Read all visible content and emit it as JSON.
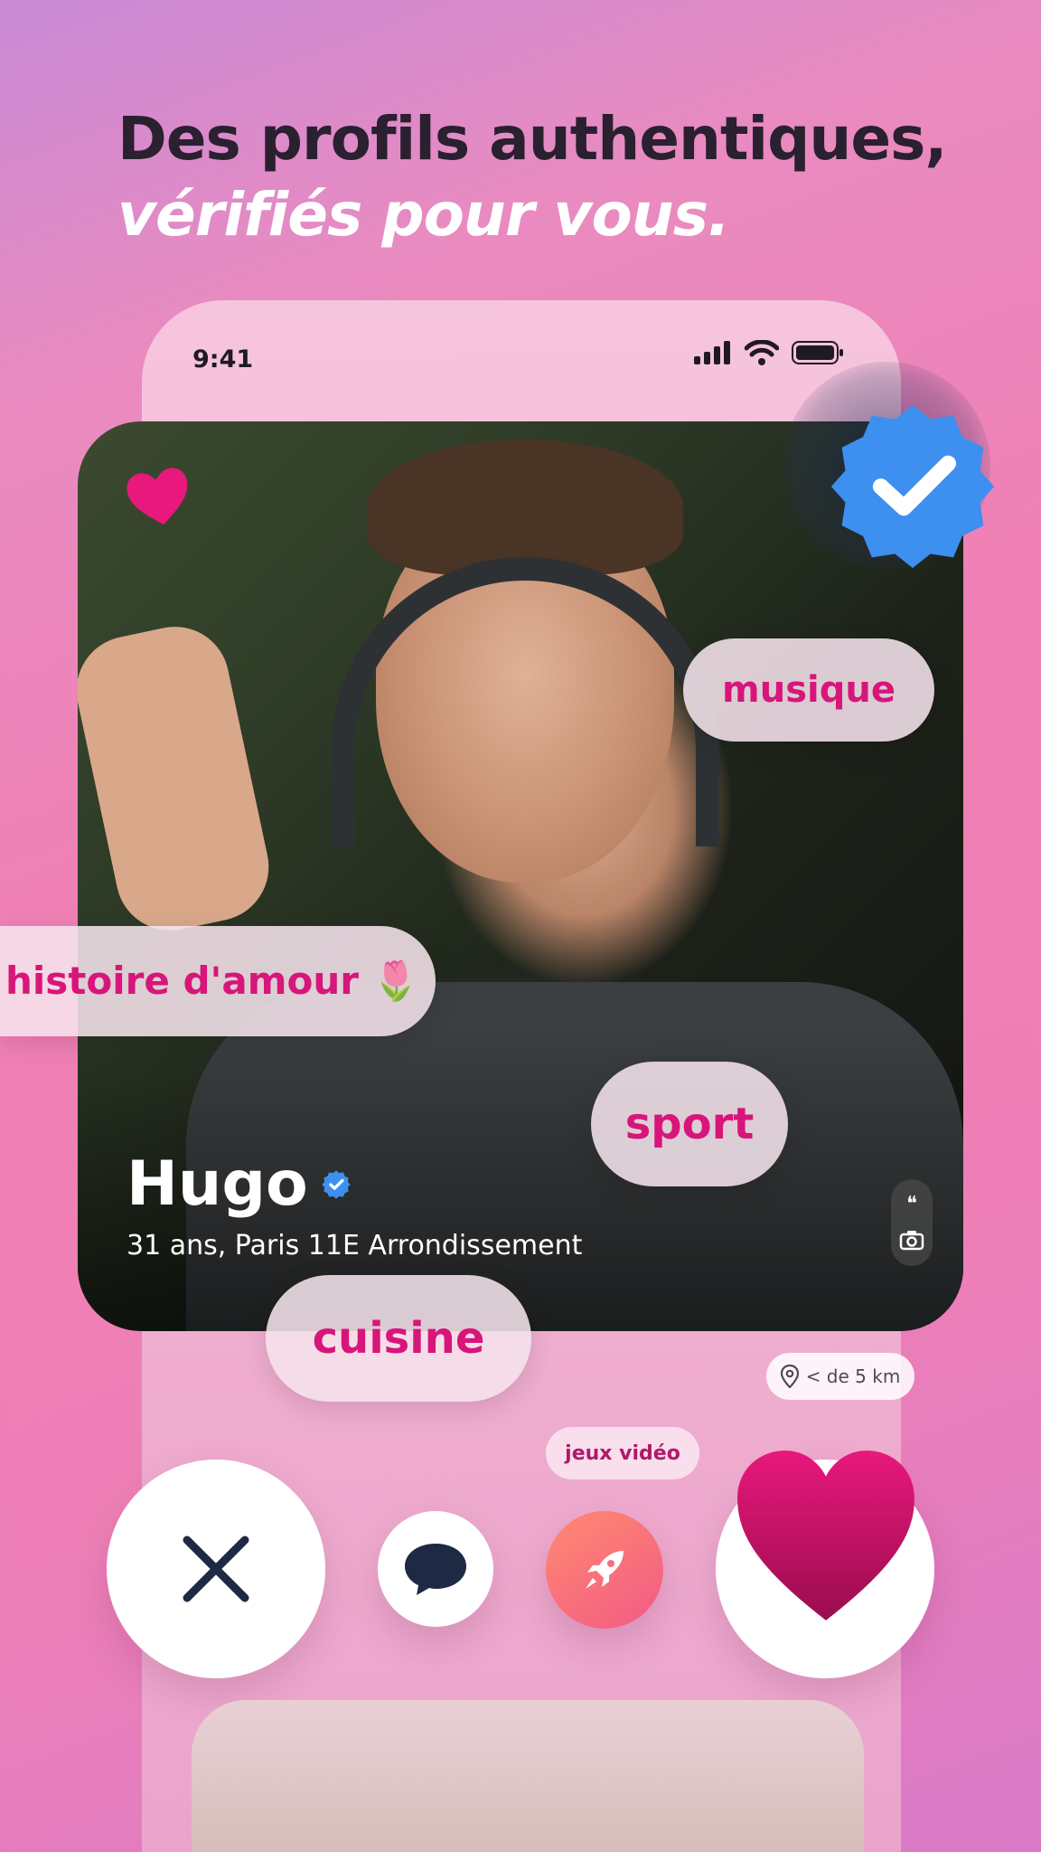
{
  "headline": {
    "line1": "Des profils authentiques,",
    "line2": "vérifiés pour vous."
  },
  "status_bar": {
    "time": "9:41"
  },
  "profile": {
    "name": "Hugo",
    "details": "31 ans, Paris 11E Arrondissement",
    "verified": true
  },
  "tags": {
    "musique": "musique",
    "amour": "histoire d'amour 🌷",
    "sport": "sport",
    "cuisine": "cuisine",
    "jeux": "jeux vidéo"
  },
  "distance": "< de 5 km",
  "side_pill": {
    "quote": "❝",
    "camera": "📷"
  },
  "colors": {
    "accent": "#d8157a",
    "verified_blue": "#3d8ff0",
    "heart_pink": "#e8187c",
    "dark_navy": "#1e2a44"
  },
  "icons": {
    "small_heart": "heart-icon",
    "verified": "verified-badge-icon",
    "dislike": "close-icon",
    "message": "chat-bubble-icon",
    "boost": "rocket-icon",
    "like": "heart-icon",
    "distance": "location-pin-icon"
  }
}
